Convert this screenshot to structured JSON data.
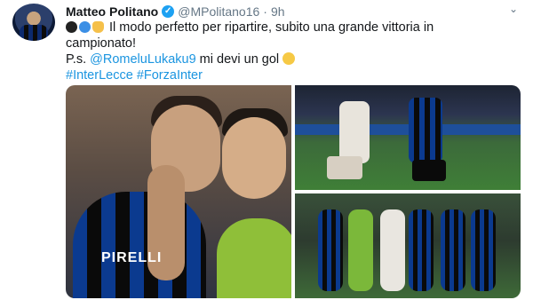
{
  "tweet": {
    "author_name": "Matteo Politano",
    "handle": "@MPolitano16",
    "separator": "·",
    "time": "9h",
    "verified_badge": "✓",
    "menu_icon": "chevron-down-icon",
    "text_line1": "Il modo perfetto per ripartire, subito una grande vittoria in",
    "text_line2": "campionato!",
    "ps_prefix": "P.s. ",
    "mention": "@RomeluLukaku9",
    "ps_suffix": " mi devi un gol ",
    "hashtag1": "#InterLecce",
    "hashtag2": "#ForzaInter"
  },
  "media": {
    "left_photo_sponsor_text": "PIRELLI"
  },
  "colors": {
    "link": "#1b95e0",
    "verified": "#1da1f2",
    "secondary_text": "#657786"
  }
}
